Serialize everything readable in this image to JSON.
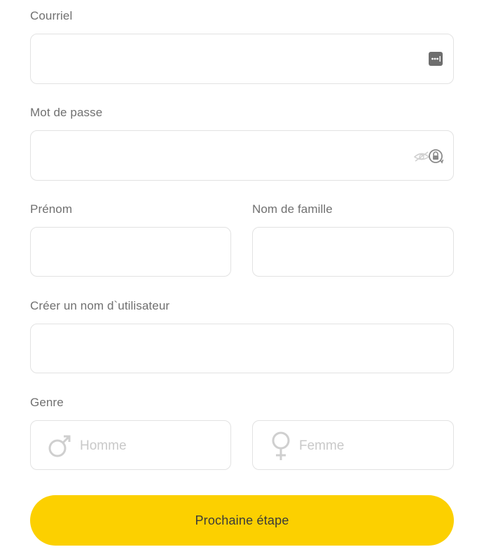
{
  "form": {
    "email": {
      "label": "Courriel",
      "value": "",
      "icon": "password-manager-icon"
    },
    "password": {
      "label": "Mot de passe",
      "value": "",
      "icon": "hidden-password-lock-icon"
    },
    "first_name": {
      "label": "Prénom",
      "value": ""
    },
    "last_name": {
      "label": "Nom de famille",
      "value": ""
    },
    "username": {
      "label": "Créer un nom d`utilisateur",
      "value": ""
    },
    "gender": {
      "label": "Genre",
      "options": [
        {
          "label": "Homme",
          "icon": "male-symbol-icon"
        },
        {
          "label": "Femme",
          "icon": "female-symbol-icon"
        }
      ]
    },
    "submit_label": "Prochaine étape"
  },
  "colors": {
    "accent": "#fcd000",
    "border": "#e2e2e2",
    "label": "#707070",
    "placeholder": "#c9c9c9"
  }
}
